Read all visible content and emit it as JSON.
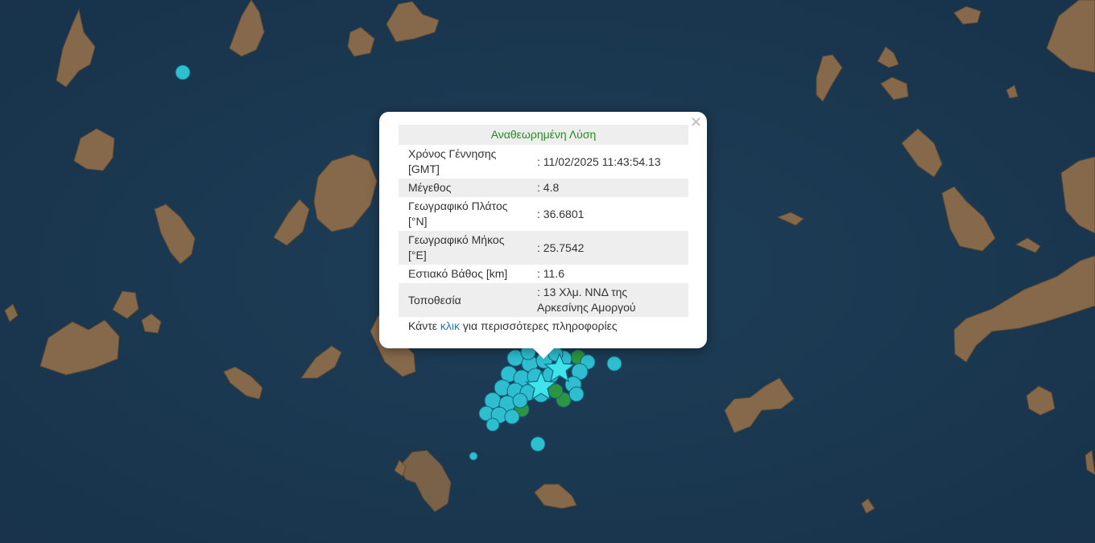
{
  "popup": {
    "title": "Αναθεωρημένη Λύση",
    "close_symbol": "×",
    "rows": [
      {
        "label": "Χρόνος Γέννησης [GMT]",
        "value": ": 11/02/2025 11:43:54.13"
      },
      {
        "label": "Μέγεθος",
        "value": ": 4.8"
      },
      {
        "label": "Γεωγραφικό Πλάτος [°N]",
        "value": ": 36.6801"
      },
      {
        "label": "Γεωγραφικό Μήκος [°E]",
        "value": ": 25.7542"
      },
      {
        "label": "Εστιακό Βάθος [km]",
        "value": ": 11.6"
      },
      {
        "label": "Τοποθεσία",
        "value": ": 13 Χλμ. ΝΝΔ της Αρκεσίνης Αμοργού"
      }
    ],
    "footer_before": "Κάντε ",
    "footer_link": "κλικ",
    "footer_after": " για περισσότερες πληροφορίες"
  },
  "map": {
    "sea_color": "#1c3a52",
    "land_color": "#8a6d4e",
    "land_dark_color": "#6e5a3f",
    "marker_cyan": "#2fc6d6",
    "marker_green": "#2e9a3f",
    "star_color": "#3fe3ea",
    "marker_icon": "earthquake-circle-icon",
    "epicenter_icon": "star-icon"
  }
}
